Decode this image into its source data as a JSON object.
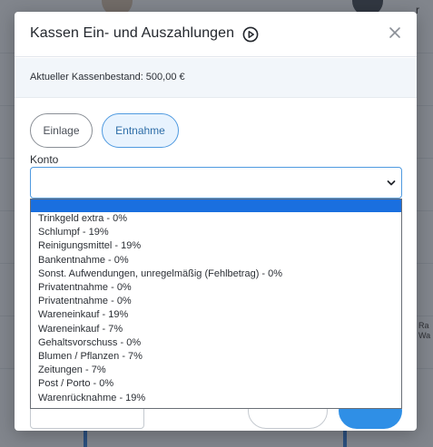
{
  "modal": {
    "title": "Kassen Ein- und Auszahlungen",
    "balance": "Aktueller Kassenbestand: 500,00 €",
    "toggle": {
      "einlage": "Einlage",
      "entnahme": "Entnahme",
      "active": "entnahme"
    },
    "konto": {
      "label": "Konto",
      "value": ""
    },
    "dropdown_options": [
      "Trinkgeld extra - 0%",
      "Schlumpf - 19%",
      "Reinigungsmittel - 19%",
      "Bankentnahme - 0%",
      "Sonst. Aufwendungen, unregelmäßig (Fehlbetrag) - 0%",
      "Privatentnahme - 0%",
      "Privatentnahme - 0%",
      "Wareneinkauf - 19%",
      "Wareneinkauf - 7%",
      "Gehaltsvorschuss - 0%",
      "Blumen / Pflanzen - 7%",
      "Zeitungen - 7%",
      "Post / Porto - 0%",
      "Warenrücknahme - 19%"
    ]
  },
  "background": {
    "corner_letter": "r",
    "side_text": [
      "Ra",
      "Wa"
    ]
  },
  "colors": {
    "accent": "#1a6fdf",
    "active_toggle_border": "#4f9ae0",
    "active_toggle_bg": "#e8f3fe",
    "save_button": "#2f8fe6"
  },
  "icons": {
    "play": "play-circle-icon",
    "close": "close-icon",
    "chevron": "chevron-down-icon"
  }
}
